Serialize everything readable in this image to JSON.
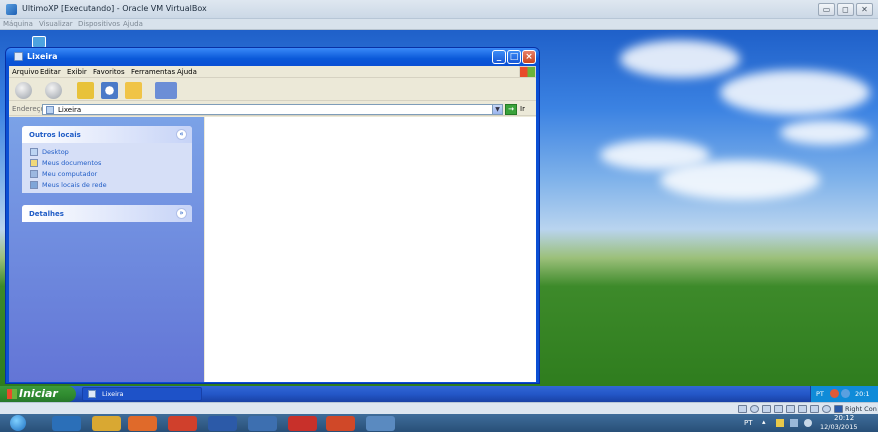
{
  "host": {
    "title": "UltimoXP [Executando] - Oracle VM VirtualBox",
    "menu": [
      "Máquina",
      "Visualizar",
      "Dispositivos",
      "Ajuda"
    ],
    "controls": [
      "▭",
      "◻",
      "✕"
    ]
  },
  "explorer": {
    "title": "Lixeira",
    "menu": [
      "Arquivo",
      "Editar",
      "Exibir",
      "Favoritos",
      "Ferramentas",
      "Ajuda"
    ],
    "address_label": "Endereço",
    "address_value": "Lixeira",
    "go_label": "Ir",
    "panels": [
      {
        "title": "Outros locais",
        "links": [
          "Desktop",
          "Meus documentos",
          "Meu computador",
          "Meus locais de rede"
        ]
      },
      {
        "title": "Detalhes",
        "links": []
      }
    ]
  },
  "xp_taskbar": {
    "start_label": "Iniciar",
    "task_label": "Lixeira",
    "tray_lang": "PT",
    "tray_time": "20:1"
  },
  "host_status": {
    "right_label": "Right Con"
  },
  "win7_taskbar": {
    "lang": "PT",
    "time": "20:12",
    "date": "12/03/2015"
  },
  "colors": {
    "xp_blue": "#0a4fd4",
    "start_green": "#2f8a2f",
    "link_blue": "#215dc6",
    "sidebar_blue": "#6375d6"
  }
}
